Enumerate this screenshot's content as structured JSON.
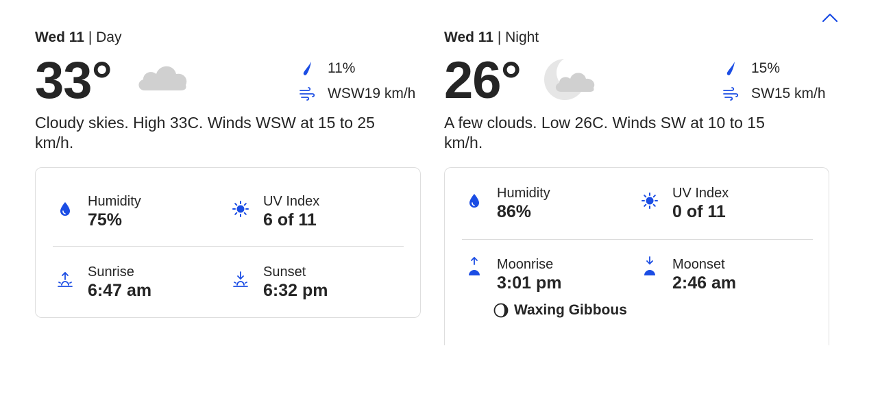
{
  "colors": {
    "accent": "#1b4de4",
    "text": "#252525",
    "cloud": "#d0d0d0",
    "border": "#dedede"
  },
  "collapse_icon": "chevron-up-icon",
  "day": {
    "date": "Wed 11",
    "separator": " | ",
    "part": "Day",
    "temperature": "33°",
    "condition_icon": "cloud-icon",
    "precip": "11%",
    "precip_icon": "raindrop-icon",
    "wind": "WSW19 km/h",
    "wind_icon": "wind-icon",
    "narrative": "Cloudy skies. High 33C. Winds WSW at 15 to 25 km/h.",
    "humidity_label": "Humidity",
    "humidity_value": "75%",
    "uv_label": "UV Index",
    "uv_value": "6 of 11",
    "sunrise_label": "Sunrise",
    "sunrise_value": "6:47 am",
    "sunset_label": "Sunset",
    "sunset_value": "6:32 pm"
  },
  "night": {
    "date": "Wed 11",
    "separator": " | ",
    "part": "Night",
    "temperature": "26°",
    "condition_icon": "moon-cloud-icon",
    "precip": "15%",
    "precip_icon": "raindrop-icon",
    "wind": "SW15 km/h",
    "wind_icon": "wind-icon",
    "narrative": "A few clouds. Low 26C. Winds SW at 10 to 15 km/h.",
    "humidity_label": "Humidity",
    "humidity_value": "86%",
    "uv_label": "UV Index",
    "uv_value": "0 of 11",
    "moonrise_label": "Moonrise",
    "moonrise_value": "3:01 pm",
    "moonset_label": "Moonset",
    "moonset_value": "2:46 am",
    "moon_phase": "Waxing Gibbous",
    "moon_phase_icon": "moon-phase-icon"
  }
}
